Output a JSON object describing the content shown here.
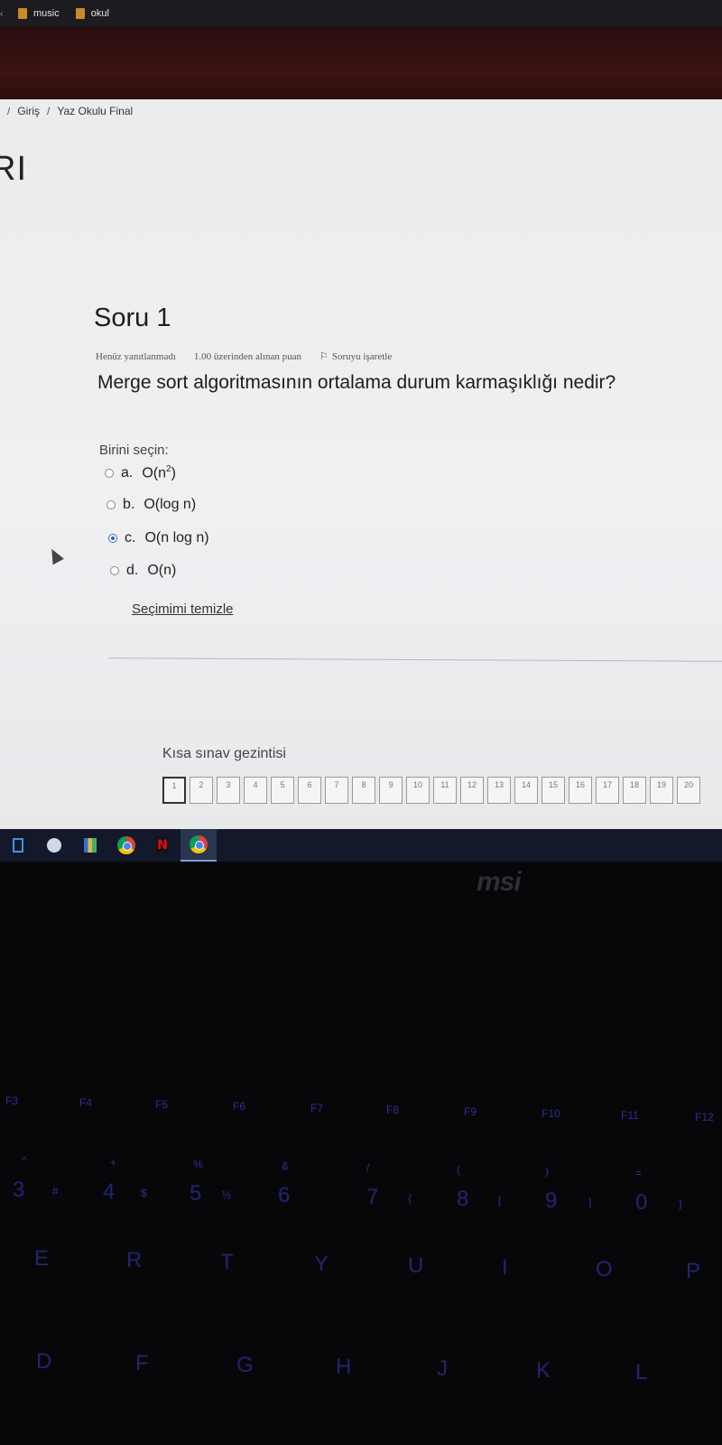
{
  "bookmarks": {
    "items": [
      {
        "label": "music"
      },
      {
        "label": "okul"
      }
    ]
  },
  "breadcrumb": {
    "items": [
      "Giriş",
      "Yaz Okulu Final"
    ]
  },
  "page_heading": "RI",
  "question": {
    "title": "Soru 1",
    "status": "Henüz yanıtlanmadı",
    "grade": "1.00 üzerinden alınan puan",
    "flag_label": "Soruyu işaretle",
    "text": "Merge sort algoritmasının ortalama durum karmaşıklığı nedir?",
    "choose_label": "Birini seçin:",
    "options": [
      {
        "letter": "a.",
        "text": "O(n",
        "sup": "2",
        "after": ")",
        "selected": false
      },
      {
        "letter": "b.",
        "text": "O(log n)",
        "selected": false
      },
      {
        "letter": "c.",
        "text": "O(n log n)",
        "selected": true
      },
      {
        "letter": "d.",
        "text": "O(n)",
        "selected": false
      }
    ],
    "clear_label": "Seçimimi temizle"
  },
  "quiz_nav": {
    "title": "Kısa sınav gezintisi",
    "buttons": [
      "1",
      "2",
      "3",
      "4",
      "5",
      "6",
      "7",
      "8",
      "9",
      "10",
      "11",
      "12",
      "13",
      "14",
      "15",
      "16",
      "17",
      "18",
      "19",
      "20"
    ],
    "current": "1"
  },
  "taskbar": {
    "icons": [
      "file-explorer-icon",
      "steam-icon",
      "books-icon",
      "chrome-icon",
      "netflix-icon",
      "chrome-active-icon"
    ]
  },
  "laptop": {
    "logo": "msi",
    "function_keys": [
      "F3",
      "F4",
      "F5",
      "F6",
      "F7",
      "F8",
      "F9",
      "F10",
      "F11",
      "F12"
    ],
    "number_row": [
      "3",
      "#",
      "4",
      "$",
      "5",
      "½",
      "6",
      "7",
      "{",
      "8",
      "[",
      "9",
      "]",
      "0",
      "}"
    ],
    "symbols": [
      "^",
      "+",
      "%",
      "&",
      "/",
      "(",
      ")",
      "="
    ],
    "letter_row_1": [
      "E",
      "R",
      "T",
      "Y",
      "U",
      "I",
      "O",
      "P"
    ],
    "letter_row_2": [
      "D",
      "F",
      "G",
      "H",
      "J",
      "K",
      "L"
    ]
  }
}
